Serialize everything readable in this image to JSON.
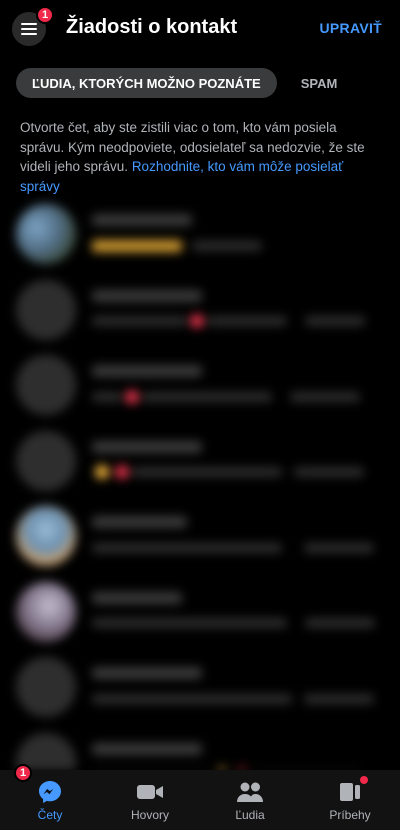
{
  "header": {
    "menu_badge": "1",
    "title": "Žiadosti o kontakt",
    "edit_label": "UPRAVIŤ"
  },
  "tabs": {
    "active": "ĽUDIA, KTORÝCH MOŽNO POZNÁTE",
    "spam": "SPAM"
  },
  "info": {
    "text": "Otvorte čet, aby ste zistili viac o tom, kto vám posiela správu. Kým neodpoviete, odosielateľ sa nedozvie, že ste videli jeho správu. ",
    "link": "Rozhodnite, kto vám môže posielať správy"
  },
  "bottom_nav": {
    "chats": {
      "label": "Čety",
      "badge": "1"
    },
    "calls": {
      "label": "Hovory"
    },
    "people": {
      "label": "Ľudia"
    },
    "stories": {
      "label": "Príbehy"
    }
  },
  "colors": {
    "accent": "#4599ff",
    "badge": "#f02849",
    "background": "#000000"
  }
}
